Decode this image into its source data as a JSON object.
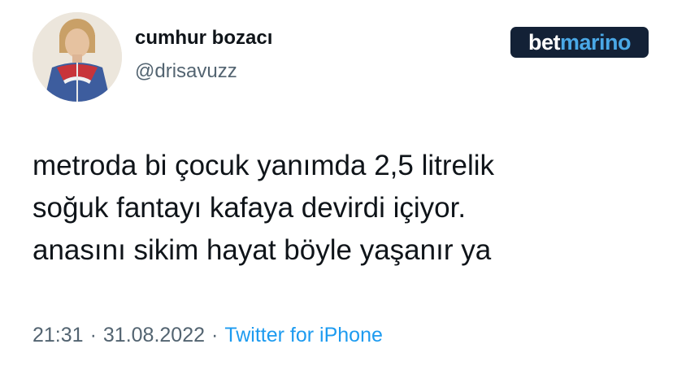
{
  "author": {
    "display_name": "cumhur bozacı",
    "handle": "@drisavuzz",
    "avatar_icon": "profile-photo-icon"
  },
  "sponsor": {
    "text_part_1": "bet",
    "text_part_2": "marino",
    "bg_color": "#132136",
    "accent_color": "#4aa8e6"
  },
  "tweet": {
    "lines": [
      "metroda bi çocuk yanımda 2,5 litrelik",
      "soğuk fantayı kafaya devirdi içiyor.",
      "anasını sikim hayat böyle yaşanır ya"
    ]
  },
  "meta": {
    "time": "21:31",
    "separator": "·",
    "date": "31.08.2022",
    "source": "Twitter for iPhone"
  },
  "colors": {
    "text_primary": "#0f1419",
    "text_secondary": "#536471",
    "link": "#1d9bf0"
  }
}
